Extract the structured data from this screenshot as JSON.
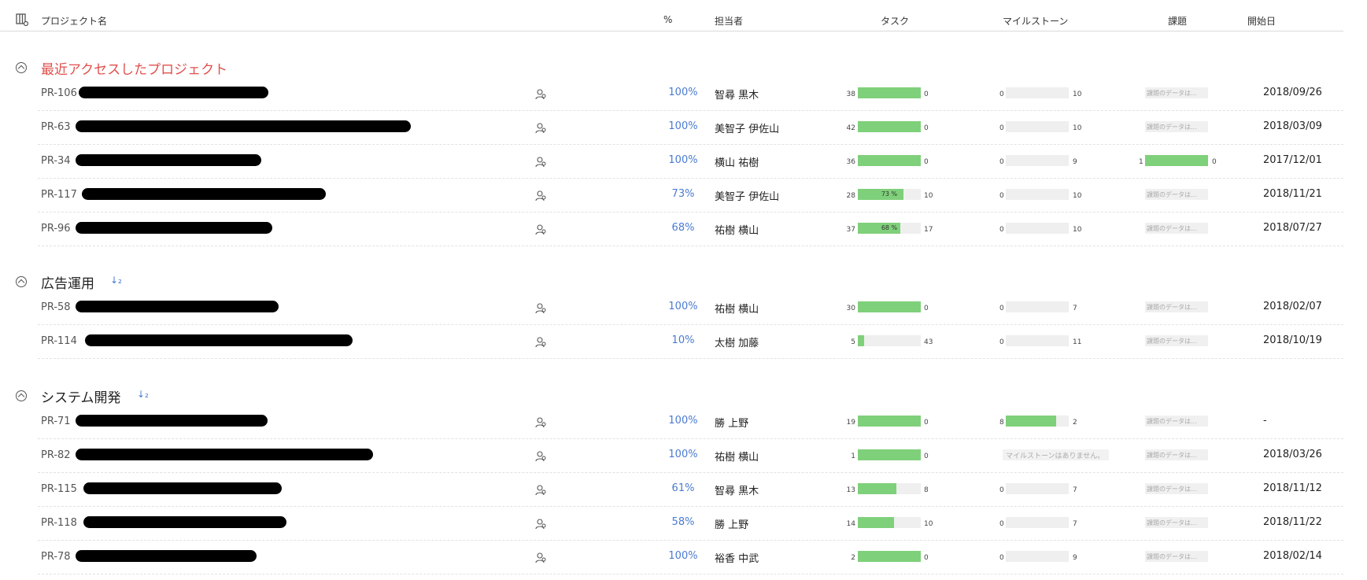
{
  "header": {
    "project_name": "プロジェクト名",
    "percent": "%",
    "owner": "担当者",
    "tasks": "タスク",
    "milestones": "マイルストーン",
    "issues": "課題",
    "start_date": "開始日"
  },
  "groups": [
    {
      "title": "最近アクセスしたプロジェクト",
      "rows": [
        {
          "id": "PR-106",
          "percent": "100%",
          "owner": "智尋 黒木",
          "task_done": "38",
          "task_open": "0",
          "task_fill": 1.0,
          "task_label": "",
          "ms_done": "0",
          "ms_open": "10",
          "ms_fill": 0,
          "ms_empty": "",
          "issue_done": "",
          "issue_open": "",
          "issue_fill": 0,
          "issue_ph": "課題のデータは...",
          "date": "2018/09/26"
        },
        {
          "id": "PR-63",
          "percent": "100%",
          "owner": "美智子 伊佐山",
          "task_done": "42",
          "task_open": "0",
          "task_fill": 1.0,
          "task_label": "",
          "ms_done": "0",
          "ms_open": "10",
          "ms_fill": 0,
          "ms_empty": "",
          "issue_done": "",
          "issue_open": "",
          "issue_fill": 0,
          "issue_ph": "課題のデータは...",
          "date": "2018/03/09"
        },
        {
          "id": "PR-34",
          "percent": "100%",
          "owner": "横山 祐樹",
          "task_done": "36",
          "task_open": "0",
          "task_fill": 1.0,
          "task_label": "",
          "ms_done": "0",
          "ms_open": "9",
          "ms_fill": 0,
          "ms_empty": "",
          "issue_done": "1",
          "issue_open": "0",
          "issue_fill": 1.0,
          "issue_ph": "",
          "date": "2017/12/01"
        },
        {
          "id": "PR-117",
          "percent": "73%",
          "owner": "美智子 伊佐山",
          "task_done": "28",
          "task_open": "10",
          "task_fill": 0.73,
          "task_label": "73 %",
          "ms_done": "0",
          "ms_open": "10",
          "ms_fill": 0,
          "ms_empty": "",
          "issue_done": "",
          "issue_open": "",
          "issue_fill": 0,
          "issue_ph": "課題のデータは...",
          "date": "2018/11/21"
        },
        {
          "id": "PR-96",
          "percent": "68%",
          "owner": "祐樹 横山",
          "task_done": "37",
          "task_open": "17",
          "task_fill": 0.68,
          "task_label": "68 %",
          "ms_done": "0",
          "ms_open": "10",
          "ms_fill": 0,
          "ms_empty": "",
          "issue_done": "",
          "issue_open": "",
          "issue_fill": 0,
          "issue_ph": "課題のデータは...",
          "date": "2018/07/27"
        }
      ]
    },
    {
      "title": "広告運用",
      "rows": [
        {
          "id": "PR-58",
          "percent": "100%",
          "owner": "祐樹 横山",
          "task_done": "30",
          "task_open": "0",
          "task_fill": 1.0,
          "task_label": "",
          "ms_done": "0",
          "ms_open": "7",
          "ms_fill": 0,
          "ms_empty": "",
          "issue_done": "",
          "issue_open": "",
          "issue_fill": 0,
          "issue_ph": "課題のデータは...",
          "date": "2018/02/07"
        },
        {
          "id": "PR-114",
          "percent": "10%",
          "owner": "太樹 加藤",
          "task_done": "5",
          "task_open": "43",
          "task_fill": 0.1,
          "task_label": "",
          "ms_done": "0",
          "ms_open": "11",
          "ms_fill": 0,
          "ms_empty": "",
          "issue_done": "",
          "issue_open": "",
          "issue_fill": 0,
          "issue_ph": "課題のデータは...",
          "date": "2018/10/19"
        }
      ]
    },
    {
      "title": "システム開発",
      "rows": [
        {
          "id": "PR-71",
          "percent": "100%",
          "owner": "勝 上野",
          "task_done": "19",
          "task_open": "0",
          "task_fill": 1.0,
          "task_label": "",
          "ms_done": "8",
          "ms_open": "2",
          "ms_fill": 0.8,
          "ms_empty": "",
          "issue_done": "",
          "issue_open": "",
          "issue_fill": 0,
          "issue_ph": "課題のデータは...",
          "date": "-"
        },
        {
          "id": "PR-82",
          "percent": "100%",
          "owner": "祐樹 横山",
          "task_done": "1",
          "task_open": "0",
          "task_fill": 1.0,
          "task_label": "",
          "ms_done": "",
          "ms_open": "",
          "ms_fill": 0,
          "ms_empty": "マイルストーンはありません。",
          "issue_done": "",
          "issue_open": "",
          "issue_fill": 0,
          "issue_ph": "課題のデータは...",
          "date": "2018/03/26"
        },
        {
          "id": "PR-115",
          "percent": "61%",
          "owner": "智尋 黒木",
          "task_done": "13",
          "task_open": "8",
          "task_fill": 0.61,
          "task_label": "",
          "ms_done": "0",
          "ms_open": "7",
          "ms_fill": 0,
          "ms_empty": "",
          "issue_done": "",
          "issue_open": "",
          "issue_fill": 0,
          "issue_ph": "課題のデータは...",
          "date": "2018/11/12"
        },
        {
          "id": "PR-118",
          "percent": "58%",
          "owner": "勝 上野",
          "task_done": "14",
          "task_open": "10",
          "task_fill": 0.58,
          "task_label": "",
          "ms_done": "0",
          "ms_open": "7",
          "ms_fill": 0,
          "ms_empty": "",
          "issue_done": "",
          "issue_open": "",
          "issue_fill": 0,
          "issue_ph": "課題のデータは...",
          "date": "2018/11/22"
        },
        {
          "id": "PR-78",
          "percent": "100%",
          "owner": "裕香 中武",
          "task_done": "2",
          "task_open": "0",
          "task_fill": 1.0,
          "task_label": "",
          "ms_done": "0",
          "ms_open": "9",
          "ms_fill": 0,
          "ms_empty": "",
          "issue_done": "",
          "issue_open": "",
          "issue_fill": 0,
          "issue_ph": "課題のデータは...",
          "date": "2018/02/14"
        }
      ]
    }
  ],
  "colors": {
    "accent": "#4a7bd0",
    "recent_title": "#e0504d",
    "bar_fill": "#7fd07a",
    "bar_track": "#efefef"
  },
  "icons": {
    "column_settings": "columns-settings-icon",
    "toggle": "collapse-chevron-icon",
    "sort": "sort-icon",
    "user": "users-icon"
  },
  "sort_glyph": "↓₂"
}
